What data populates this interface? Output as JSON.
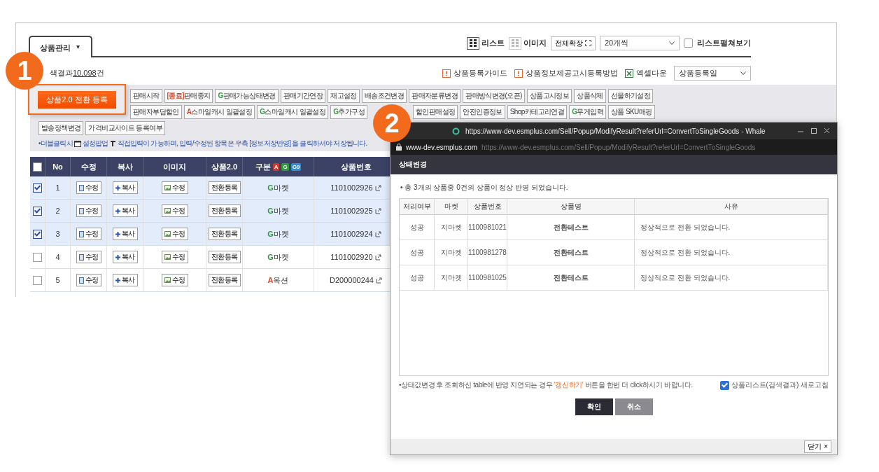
{
  "header": {
    "tab": {
      "label": "상품관리",
      "caret": "▾"
    },
    "view_options": [
      {
        "label": "리스트",
        "selected": true
      },
      {
        "label": "이미지",
        "selected": false
      }
    ],
    "expand_button": "전체확장",
    "page_size": "20개씩",
    "list_toggle": {
      "label": "리스트펼쳐보기",
      "checked": false
    }
  },
  "result": {
    "label": "색결과",
    "count": "10,098건"
  },
  "links": [
    {
      "label": "상품등록가이드",
      "kind": "guide"
    },
    {
      "label": "상품정보제공고시등록방법",
      "kind": "guide"
    },
    {
      "label": "엑셀다운",
      "kind": "excel"
    }
  ],
  "sort_select": "상품등록일",
  "highlight_button": "상품2.0 전환 등록",
  "action_rows": [
    [
      {
        "label": "판매시작"
      },
      {
        "prefix": "[종료]",
        "color": "#e0442a",
        "label": "판매중지"
      },
      {
        "prefix": "G",
        "color": "#2f9a3c",
        "label": "판매가능상태변경"
      },
      {
        "label": "판매기간연장"
      },
      {
        "label": "재고설정"
      },
      {
        "label": "배송조건변경"
      },
      {
        "label": "판매자분류변경"
      },
      {
        "label": "판매방식변경(오픈)"
      },
      {
        "label": "상품고시정보"
      },
      {
        "label": "상품삭제"
      },
      {
        "label": "선물하기설정"
      }
    ],
    [
      {
        "label": "판매자부담할인"
      },
      {
        "prefix": "A",
        "color": "#e0442a",
        "label": "스마일캐시 일괄설정"
      },
      {
        "prefix": "G",
        "color": "#2f9a3c",
        "label": "스마일캐시 일괄설정"
      },
      {
        "prefix": "G",
        "color": "#2f9a3c",
        "label": "추가구성"
      },
      {
        "label": "할인판매설정"
      },
      {
        "label": "안전인증정보"
      },
      {
        "label": "Shop카테고리연결"
      },
      {
        "prefix": "G",
        "color": "#2f9a3c",
        "label": "무게입력"
      },
      {
        "label": "상품 SKU매핑"
      }
    ],
    [
      {
        "label": "발송정책변경"
      },
      {
        "label": "가격비교사이트 등록여부"
      }
    ]
  ],
  "help": {
    "part_1": "•더블클릭시",
    "part_2": "설정팝업",
    "part_3": "직접입력이 가능하며, 입력/수정된 항목은 우측 [정보저장반영] 을 클릭하셔야 저장됩니다."
  },
  "table": {
    "all_checked": false,
    "columns": [
      "No",
      "수정",
      "복사",
      "이미지",
      "상품2.0",
      "구분",
      "상품번호"
    ],
    "market_badges": [
      {
        "label": "A",
        "color": "#d8342a"
      },
      {
        "label": "G",
        "color": "#2f9a3c"
      },
      {
        "label": "G9",
        "color": "#2a8fd6"
      }
    ],
    "rows": [
      {
        "checked": true,
        "no": "1",
        "edit": "수정",
        "copy": "복사",
        "image": "수정",
        "convert": "전환등록",
        "market": {
          "prefix": "G",
          "color": "#2f9a3c",
          "name": "마켓"
        },
        "goods_no": "1101002926"
      },
      {
        "checked": true,
        "no": "2",
        "edit": "수정",
        "copy": "복사",
        "image": "수정",
        "convert": "전환등록",
        "market": {
          "prefix": "G",
          "color": "#2f9a3c",
          "name": "마켓"
        },
        "goods_no": "1101002925"
      },
      {
        "checked": true,
        "no": "3",
        "edit": "수정",
        "copy": "복사",
        "image": "수정",
        "convert": "전환등록",
        "market": {
          "prefix": "G",
          "color": "#2f9a3c",
          "name": "마켓"
        },
        "goods_no": "1101002924"
      },
      {
        "checked": false,
        "no": "4",
        "edit": "수정",
        "copy": "복사",
        "image": "수정",
        "convert": "전환등록",
        "market": {
          "prefix": "G",
          "color": "#2f9a3c",
          "name": "마켓"
        },
        "goods_no": "1101002920"
      },
      {
        "checked": false,
        "no": "5",
        "edit": "수정",
        "copy": "복사",
        "image": "수정",
        "convert": "전환등록",
        "market": {
          "prefix": "A",
          "color": "#e0442a",
          "name": "옥션"
        },
        "goods_no": "D200000244"
      }
    ]
  },
  "popup": {
    "window_title": "https://www-dev.esmplus.com/Sell/Popup/ModifyResult?referUrl=ConvertToSingleGoods - Whale",
    "domain": "www-dev.esmplus.com",
    "url": "https://www-dev.esmplus.com/Sell/Popup/ModifyResult?referUrl=ConvertToSingleGoods",
    "heading": "상태변경",
    "message": "• 총 3개의 상품중 0건의 상품이 정상 반영 되었습니다.",
    "columns": [
      "처리여부",
      "마켓",
      "상품번호",
      "상품명",
      "사유"
    ],
    "rows": [
      [
        "성공",
        "지마켓",
        "1100981021",
        "전환테스트",
        "정상적으로 전환 되었습니다."
      ],
      [
        "성공",
        "지마켓",
        "1100981278",
        "전환테스트",
        "정상적으로 전환 되었습니다."
      ],
      [
        "성공",
        "지마켓",
        "1100981025",
        "전환테스트",
        "정상적으로 전환 되었습니다."
      ]
    ],
    "note_before": "•상태값변경 후 조회하신 table에 반영 지연되는 경우",
    "note_highlight": "'갱신하기'",
    "note_after": "버튼을 한번 더 click하시기 바랍니다.",
    "refresh": {
      "label": "상품리스트(검색결과) 새로고침",
      "checked": true
    },
    "buttons": [
      {
        "label": "확인",
        "kind": "primary"
      },
      {
        "label": "취소",
        "kind": "secondary"
      }
    ],
    "close": "닫기 ×"
  },
  "badges": [
    "1",
    "2"
  ]
}
